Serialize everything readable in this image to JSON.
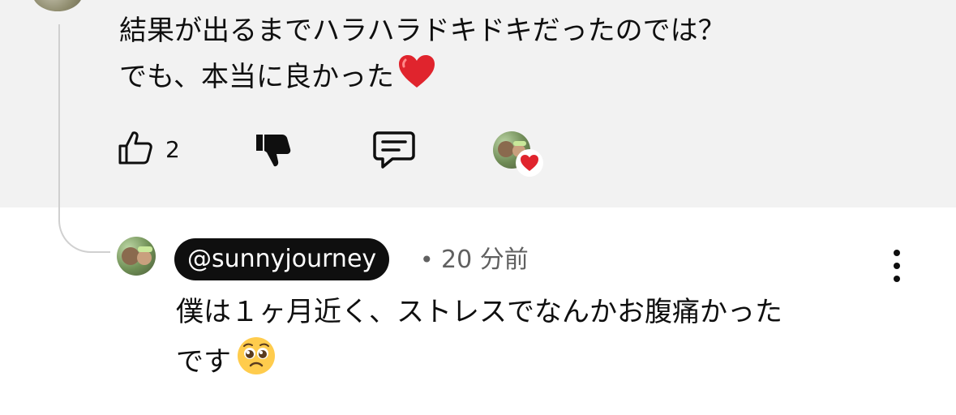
{
  "parent_comment": {
    "text_line1": "結果が出るまでハラハラドキドキだったのでは？",
    "text_line2": "でも、本当に良かった",
    "heart_emoji_icon": "red-heart-emoji",
    "like_count": "2"
  },
  "reply": {
    "author": "@sunnyjourney",
    "separator": "•",
    "time": "20 分前",
    "text_line1": "僕は１ヶ月近く、ストレスでなんかお腹痛かった",
    "text_line2": "です",
    "emoji_icon": "pleading-face-emoji"
  },
  "colors": {
    "top_panel_bg": "#f2f2f2",
    "chip_bg": "#0f0f0f",
    "meta_gray": "#606060",
    "heart_red": "#e0242d"
  }
}
